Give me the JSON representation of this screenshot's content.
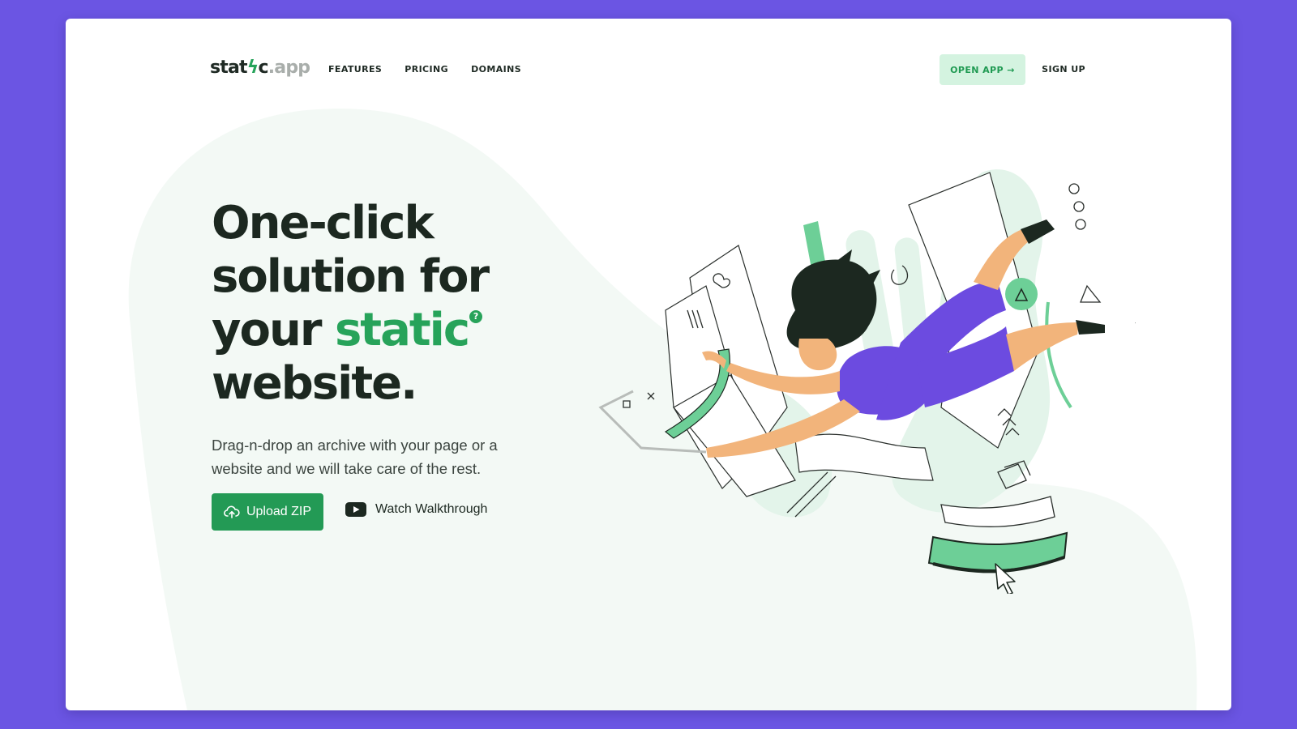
{
  "brand": {
    "name_part1": "stat",
    "name_bolt": "ϟ",
    "name_part2": "c",
    "tld": ".app"
  },
  "nav": {
    "links": [
      "FEATURES",
      "PRICING",
      "DOMAINS"
    ],
    "open_app_label": "OPEN APP →",
    "sign_up_label": "SIGN UP"
  },
  "hero": {
    "title_line1": "One-click",
    "title_line2": "solution for",
    "title_line3_prefix": "your ",
    "title_line3_accent": "static",
    "title_qmark": "?",
    "title_line4": "website.",
    "subtitle": "Drag-n-drop an archive with your page or a website and we will take care of the rest.",
    "upload_label": "Upload ZIP",
    "watch_label": "Watch Walkthrough"
  },
  "colors": {
    "page_background": "#6b55e3",
    "accent_green": "#27a35a",
    "light_green": "#d4f3e0",
    "blob": "#f3f9f5",
    "character_purple": "#6c4be0"
  },
  "icons": [
    "upload-cloud-icon",
    "youtube-play-icon",
    "arrow-right-icon"
  ]
}
